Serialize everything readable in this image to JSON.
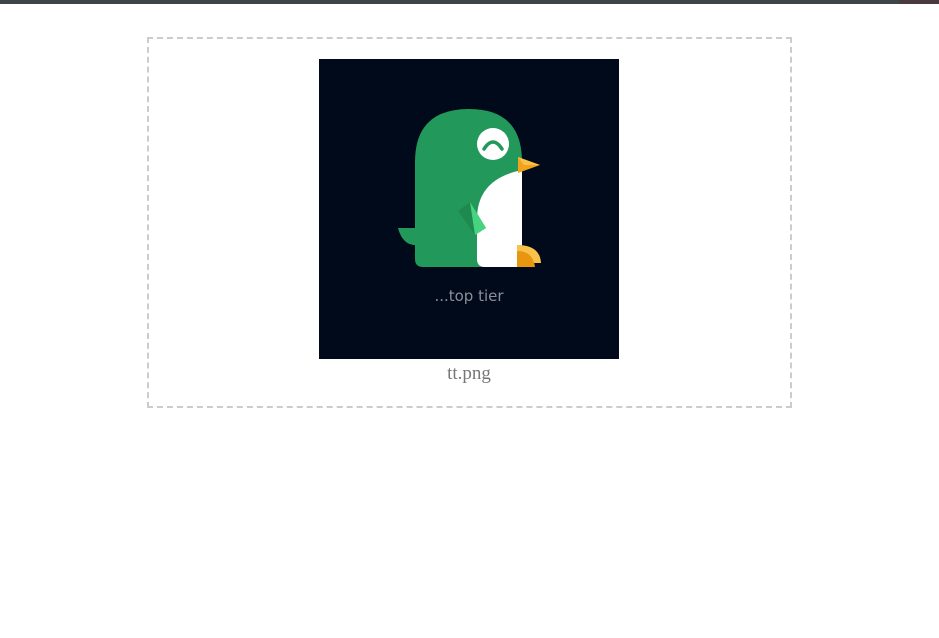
{
  "upload": {
    "preview_caption": "...top tier",
    "file_name": "tt.png"
  },
  "colors": {
    "top_bar": "#3d4549",
    "image_background": "#010a1b",
    "penguin_body": "#22995a",
    "penguin_belly": "#ffffff",
    "beak_and_feet": "#f0a41e",
    "wing_highlight": "#4fe08a"
  },
  "icons": {
    "preview_image": "penguin-logo-icon"
  }
}
